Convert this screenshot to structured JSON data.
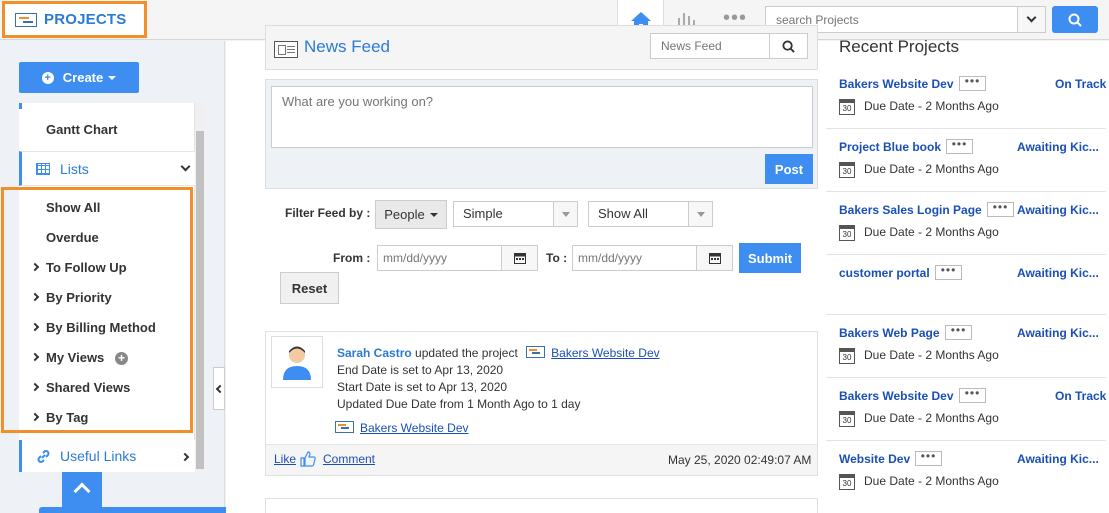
{
  "header": {
    "brand": "PROJECTS",
    "search_placeholder": "search Projects",
    "home_icon": "home-icon",
    "reports_icon": "bar-chart-icon",
    "more_icon": "more-dots-icon"
  },
  "sidebar": {
    "create_label": "Create",
    "gantt_label": "Gantt Chart",
    "lists_label": "Lists",
    "list_items": [
      {
        "label": "Show All"
      },
      {
        "label": "Overdue"
      },
      {
        "label": "To Follow Up"
      },
      {
        "label": "By Priority"
      },
      {
        "label": "By Billing Method"
      },
      {
        "label": "My Views"
      },
      {
        "label": "Shared Views"
      },
      {
        "label": "By Tag"
      }
    ],
    "useful_links_label": "Useful Links"
  },
  "feed": {
    "title": "News Feed",
    "search_placeholder": "News Feed",
    "composer_placeholder": "What are you working on?",
    "post_label": "Post",
    "filter_label": "Filter Feed by :",
    "people_label": "People",
    "type_select": "Simple",
    "show_select": "Show All",
    "from_label": "From :",
    "to_label": "To :",
    "date_placeholder": "mm/dd/yyyy",
    "submit_label": "Submit",
    "reset_label": "Reset",
    "post": {
      "user": "Sarah Castro",
      "action": "updated the project",
      "project": "Bakers Website Dev",
      "line1": "End Date is set to Apr 13, 2020",
      "line2": "Start Date is set to Apr 13, 2020",
      "line3": "Updated Due Date from 1 Month Ago to 1 day",
      "project_link": "Bakers Website Dev",
      "like": "Like",
      "comment": "Comment",
      "timestamp": "May 25, 2020 02:49:07 AM"
    }
  },
  "recent": {
    "title": "Recent Projects",
    "items": [
      {
        "name": "Bakers Website Dev",
        "status": "On Track",
        "due": "Due Date - 2 Months Ago"
      },
      {
        "name": "Project Blue book",
        "status": "Awaiting Kic...",
        "due": "Due Date - 2 Months Ago"
      },
      {
        "name": "Bakers Sales Login Page",
        "status": "Awaiting Kic...",
        "due": "Due Date - 2 Months Ago"
      },
      {
        "name": "customer portal",
        "status": "Awaiting Kic...",
        "due": ""
      },
      {
        "name": "Bakers Web Page",
        "status": "Awaiting Kic...",
        "due": "Due Date - 2 Months Ago"
      },
      {
        "name": "Bakers Website Dev",
        "status": "On Track",
        "due": "Due Date - 2 Months Ago"
      },
      {
        "name": "Website Dev",
        "status": "Awaiting Kic...",
        "due": "Due Date - 2 Months Ago"
      }
    ],
    "calendar_day": "30"
  },
  "colors": {
    "accent": "#3d8ef0",
    "highlight": "#f0902a",
    "link": "#1a4fb5"
  }
}
